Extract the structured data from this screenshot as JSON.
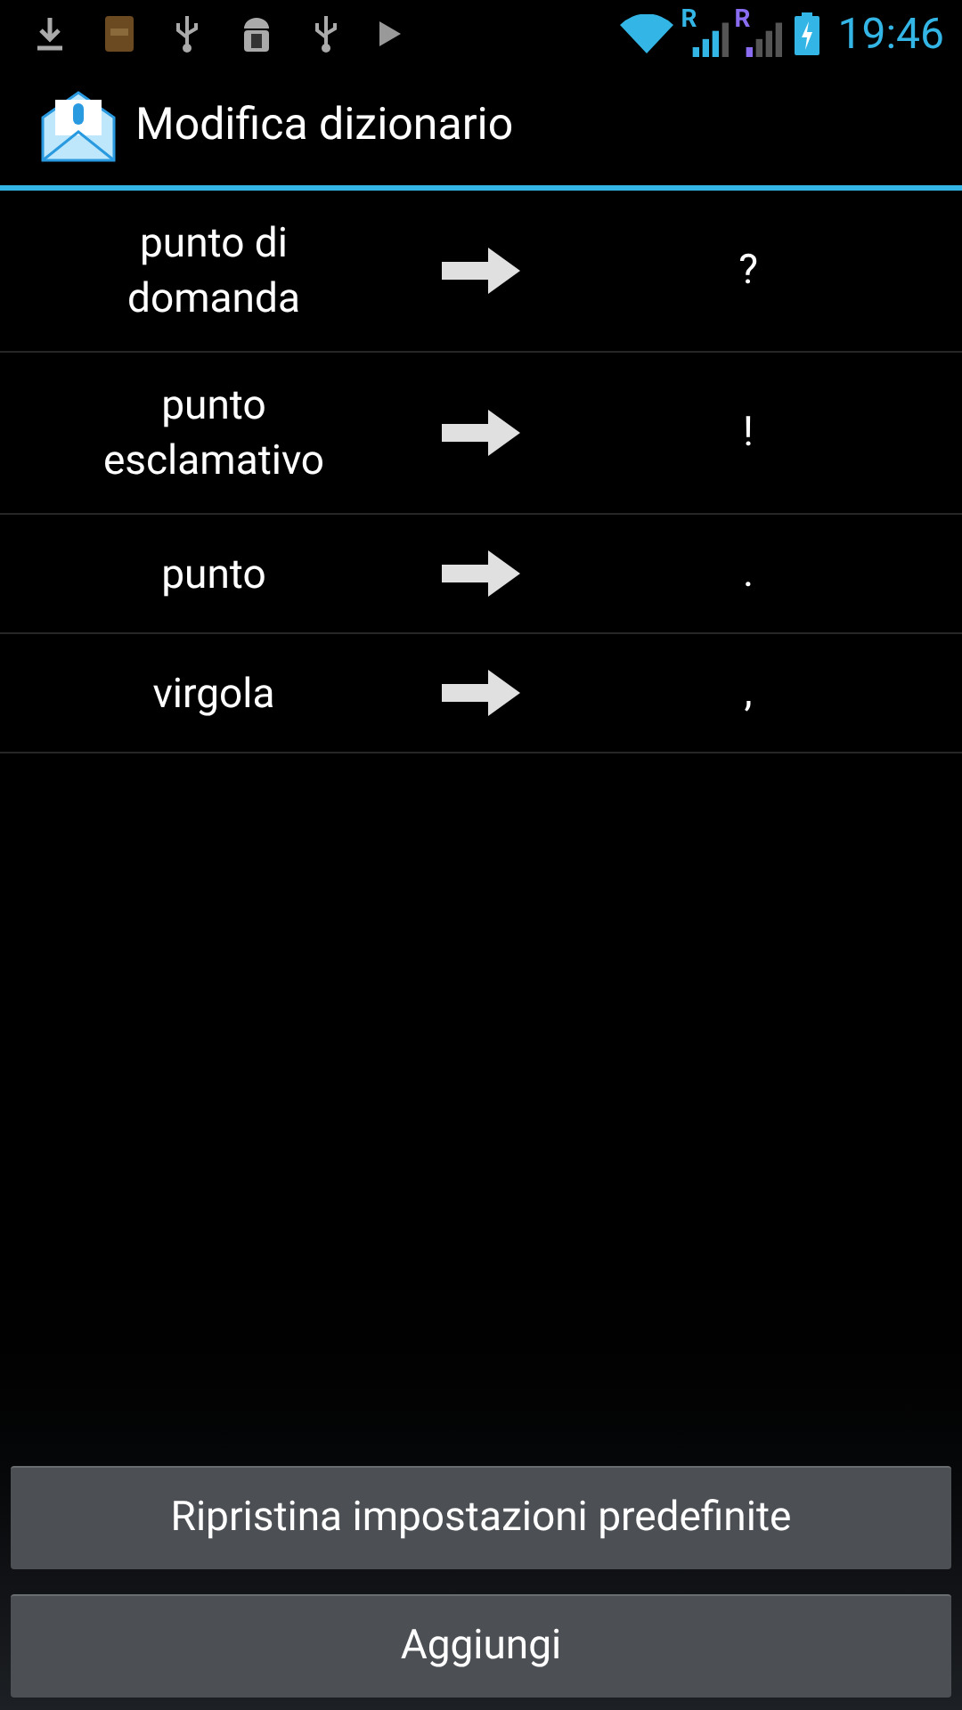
{
  "status_bar": {
    "signals": [
      {
        "label": "R",
        "color": "#33b5e5",
        "level": 0.75
      },
      {
        "label": "R",
        "color": "#8a6cf0",
        "level": 0.25
      }
    ],
    "time": "19:46"
  },
  "action_bar": {
    "title": "Modifica dizionario"
  },
  "entries": [
    {
      "phrase": "punto di domanda",
      "symbol": "?"
    },
    {
      "phrase": "punto esclamativo",
      "symbol": "!"
    },
    {
      "phrase": "punto",
      "symbol": "."
    },
    {
      "phrase": "virgola",
      "symbol": ","
    }
  ],
  "buttons": [
    "Ripristina impostazioni predefinite",
    "Aggiungi"
  ]
}
